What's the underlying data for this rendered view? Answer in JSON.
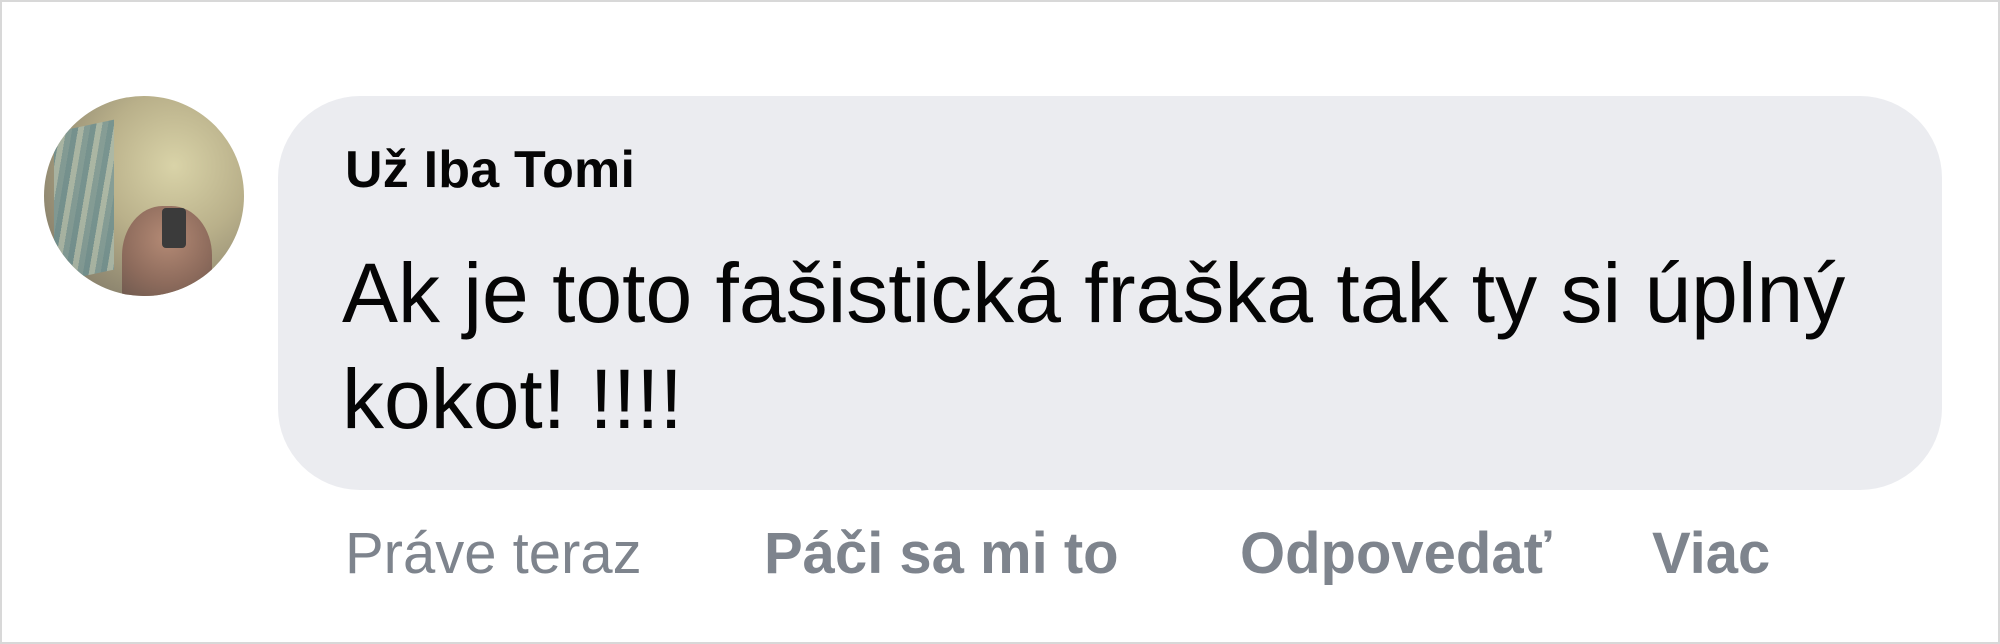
{
  "comment": {
    "author": "Už Iba Tomi",
    "text": "Ak je toto fašistická fraška tak ty si úplný kokot! !!!!",
    "timestamp": "Práve teraz",
    "actions": {
      "like": "Páči sa mi to",
      "reply": "Odpovedať",
      "more": "Viac"
    },
    "avatar_icon": "user-profile-photo"
  },
  "colors": {
    "bubble": "#ebecf0",
    "text": "#050505",
    "secondary": "#7e848d"
  }
}
